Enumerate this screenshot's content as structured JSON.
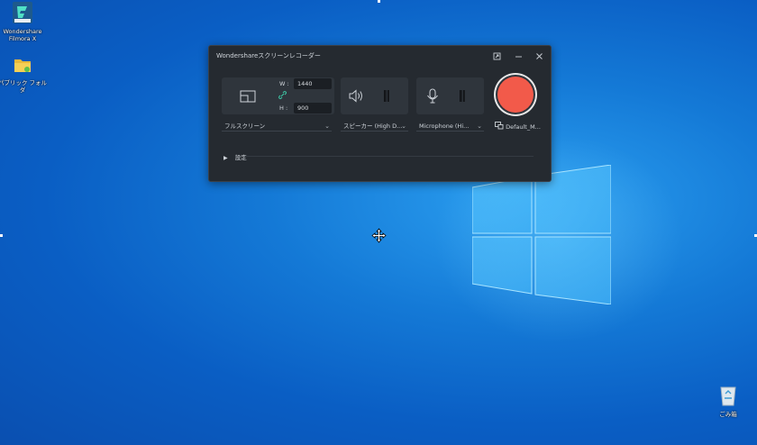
{
  "desktop": {
    "icons": [
      {
        "label": "Wondershare\nFilmora X",
        "icon": "filmora-app-icon"
      },
      {
        "label": "パブリック フォルダ",
        "icon": "folder-icon"
      },
      {
        "label": "ごみ箱",
        "icon": "recycle-bin-icon"
      }
    ]
  },
  "recorder": {
    "title": "Wondershareスクリーンレコーダー",
    "titlebar_buttons": [
      "pin-window-icon",
      "minimize-icon",
      "close-icon"
    ],
    "capture": {
      "width_label": "W :",
      "width_value": "1440",
      "height_label": "H :",
      "height_value": "900",
      "mode": "フルスクリーン"
    },
    "speaker": {
      "device": "スピーカー (High D..."
    },
    "microphone": {
      "device": "Microphone (Hi..."
    },
    "output": {
      "camera": "Default_M..."
    },
    "settings_label": "設定"
  },
  "colors": {
    "record_button": "#f25a4a",
    "window_bg": "#252a30",
    "desktop_accent": "#1479d6"
  }
}
